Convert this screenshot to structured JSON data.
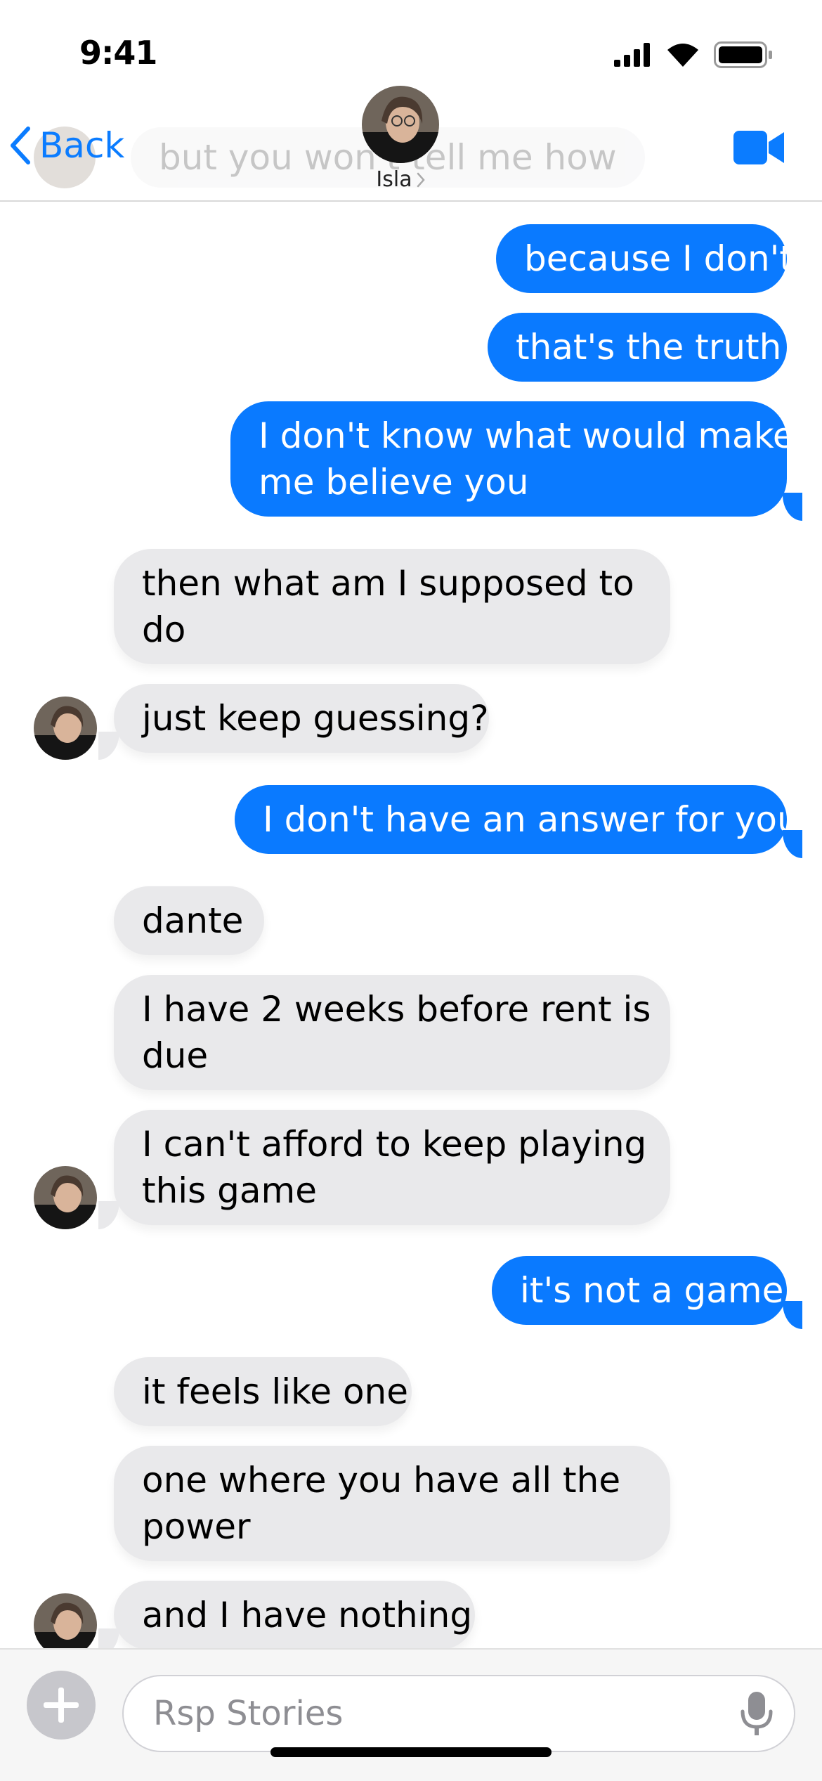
{
  "status_bar": {
    "time": "9:41",
    "icons": [
      "signal-icon",
      "wifi-icon",
      "battery-icon"
    ]
  },
  "header": {
    "back_label": "Back",
    "contact_name": "Isla",
    "ghost_message": "but you won't tell me how",
    "video_icon": "video-camera-icon"
  },
  "colors": {
    "accent": "#0a7aff",
    "received_bubble": "#e9e9eb",
    "sent_text": "#ffffff"
  },
  "messages": [
    {
      "side": "sent",
      "text": "because I don't know how"
    },
    {
      "side": "sent",
      "text": "that's the truth"
    },
    {
      "side": "sent",
      "lines": [
        "I don't know what would make",
        "me believe you"
      ]
    },
    {
      "side": "received",
      "lines": [
        "then what am I supposed to",
        "do"
      ]
    },
    {
      "side": "received",
      "text": "just keep guessing?"
    },
    {
      "side": "sent",
      "text": "I don't have an answer for you"
    },
    {
      "side": "received",
      "text": "dante"
    },
    {
      "side": "received",
      "lines": [
        "I have 2 weeks before rent is",
        "due"
      ]
    },
    {
      "side": "received",
      "lines": [
        "I can't afford to keep playing",
        "this game"
      ]
    },
    {
      "side": "sent",
      "text": "it's not a game"
    },
    {
      "side": "received",
      "text": "it feels like one"
    },
    {
      "side": "received",
      "lines": [
        "one where you have all the",
        "power"
      ]
    },
    {
      "side": "received",
      "text": "and I have nothing"
    }
  ],
  "input": {
    "placeholder": "Rsp Stories",
    "value": ""
  }
}
